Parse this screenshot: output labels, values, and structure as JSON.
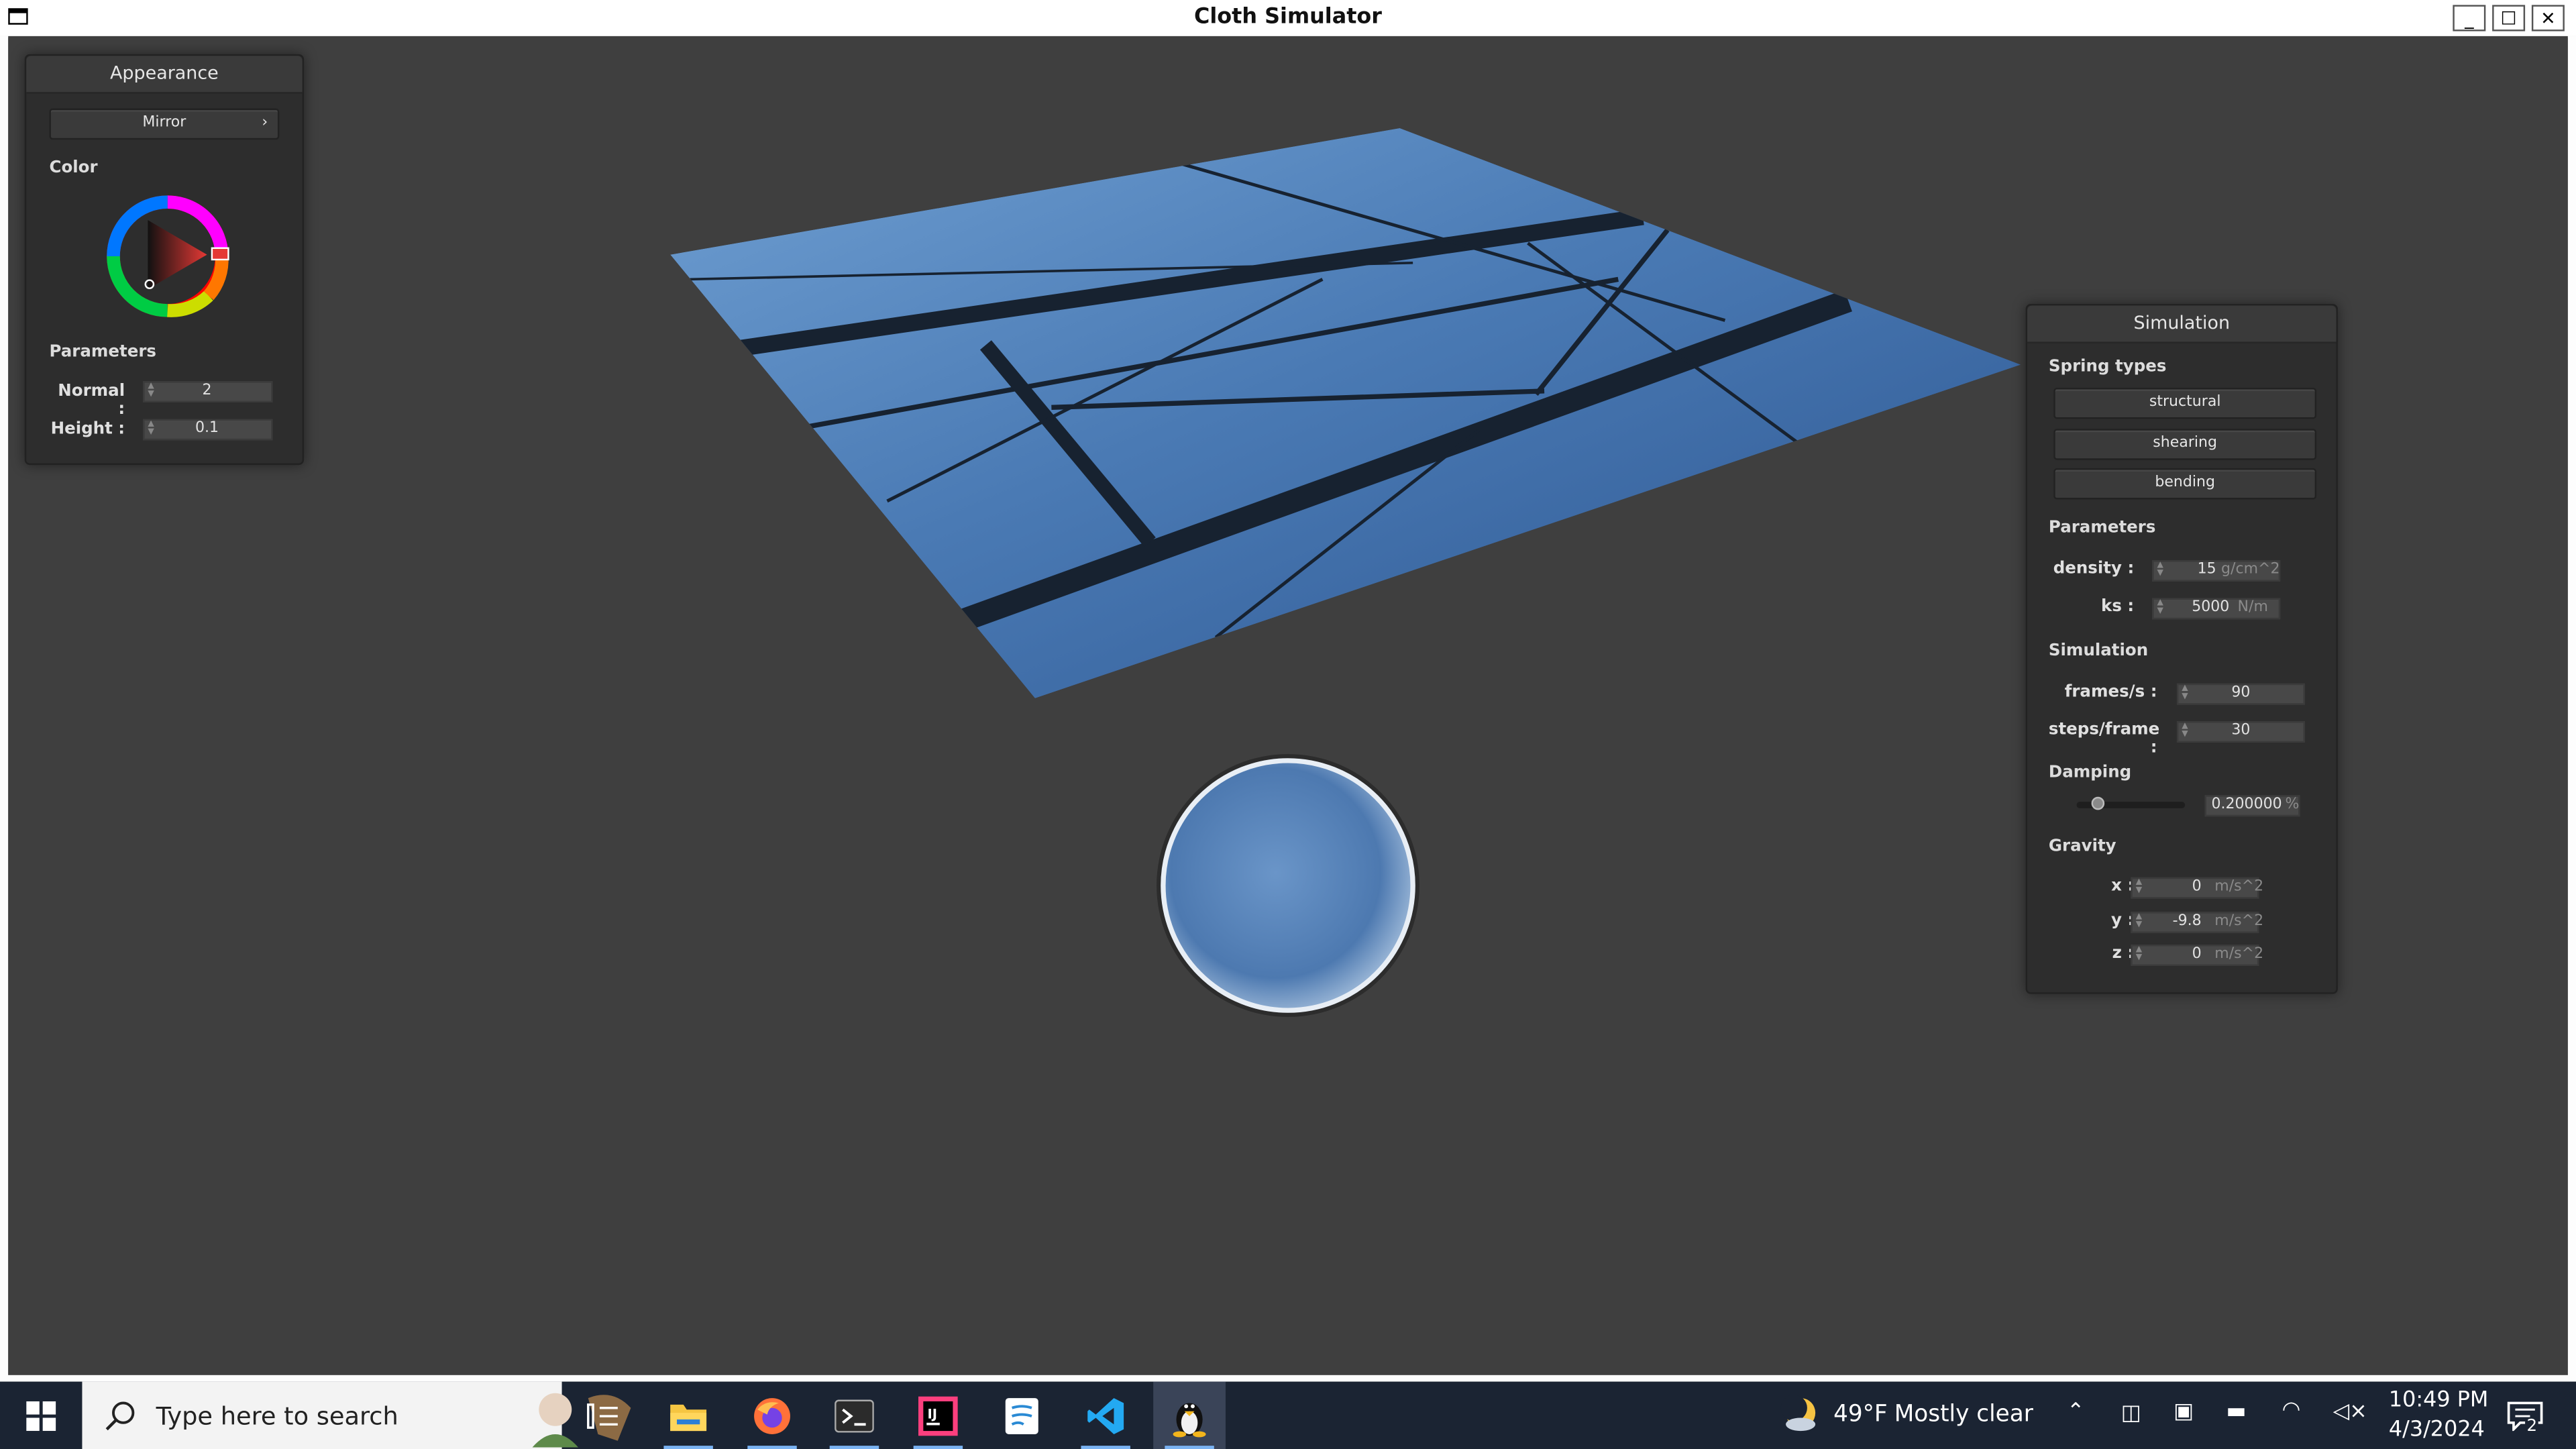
{
  "window": {
    "title": "Cloth Simulator",
    "minimize_label": "_",
    "maximize_label": "☐",
    "close_label": "✕"
  },
  "appearance_panel": {
    "title": "Appearance",
    "mode_button": "Mirror",
    "mode_arrow": "›",
    "color_label": "Color",
    "selected_color": "#e53935",
    "parameters_label": "Parameters",
    "normal_label": "Normal :",
    "normal_value": "2",
    "height_label": "Height :",
    "height_value": "0.1"
  },
  "simulation_panel": {
    "title": "Simulation",
    "spring_types_label": "Spring types",
    "spring_buttons": [
      "structural",
      "shearing",
      "bending"
    ],
    "parameters_label": "Parameters",
    "density_label": "density :",
    "density_value": "15",
    "density_unit": "g/cm^2",
    "ks_label": "ks :",
    "ks_value": "5000",
    "ks_unit": "N/m",
    "simulation_label": "Simulation",
    "fps_label": "frames/s :",
    "fps_value": "90",
    "steps_label": "steps/frame :",
    "steps_value": "30",
    "damping_label": "Damping",
    "damping_value": "0.200000",
    "damping_unit": "%",
    "damping_fraction": 0.2,
    "gravity_label": "Gravity",
    "gx_label": "x :",
    "gx_value": "0",
    "gy_label": "y :",
    "gy_value": "-9.8",
    "gz_label": "z :",
    "gz_value": "0",
    "gravity_unit": "m/s^2"
  },
  "taskbar": {
    "search_placeholder": "Type here to search",
    "apps": [
      "file-explorer-icon",
      "firefox-icon",
      "terminal-icon",
      "intellij-icon",
      "notepad-icon",
      "vscode-icon",
      "linux-icon"
    ],
    "weather_temp": "49°F",
    "weather_text": "Mostly clear",
    "time": "10:49 PM",
    "date": "4/3/2024",
    "notification_count": "2"
  },
  "colors": {
    "viewport_bg": "#3f3f3f",
    "panel_bg": "#2d2d2d",
    "taskbar_bg": "#1b2433",
    "cloth_sky": "#4a78b0"
  }
}
